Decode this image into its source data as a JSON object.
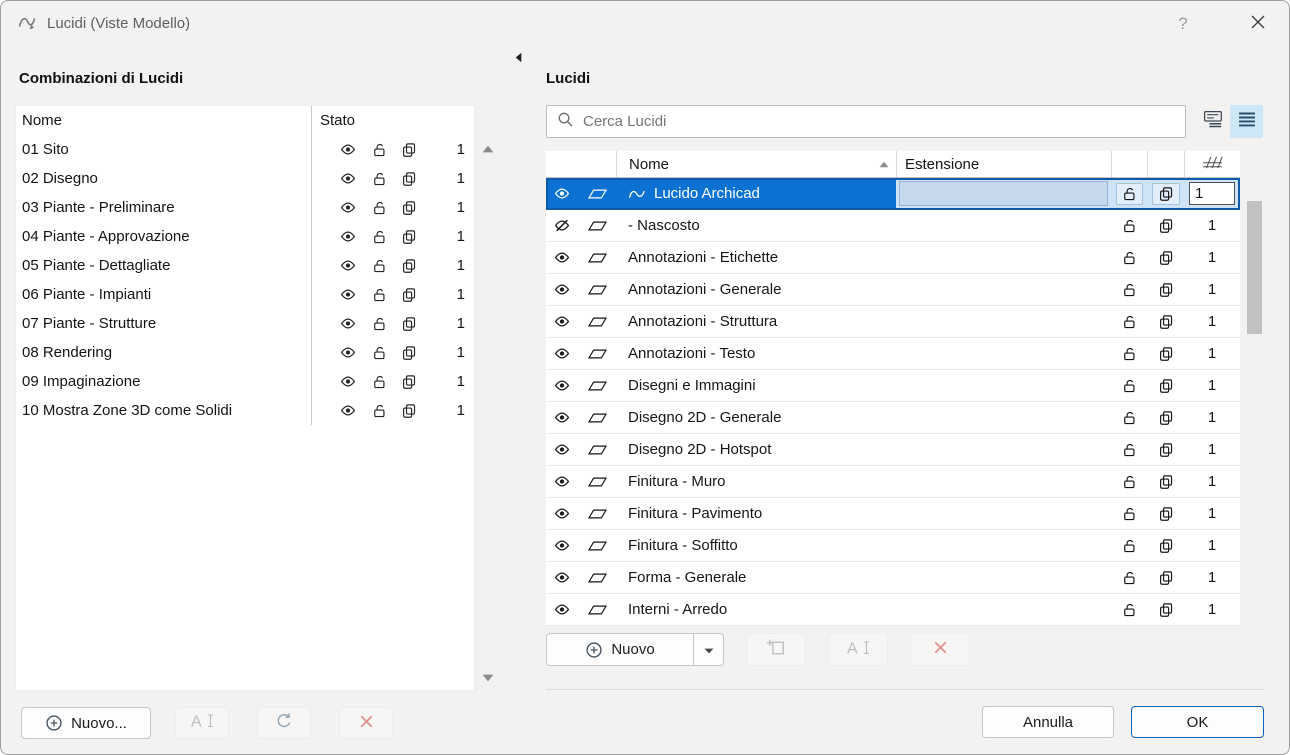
{
  "window": {
    "title": "Lucidi (Viste Modello)",
    "help": "?"
  },
  "left_panel": {
    "title": "Combinazioni di Lucidi",
    "header": {
      "name": "Nome",
      "state": "Stato"
    },
    "rows": [
      {
        "name": "01 Sito",
        "intersection": "1"
      },
      {
        "name": "02 Disegno",
        "intersection": "1"
      },
      {
        "name": "03 Piante - Preliminare",
        "intersection": "1"
      },
      {
        "name": "04 Piante - Approvazione",
        "intersection": "1"
      },
      {
        "name": "05 Piante - Dettagliate",
        "intersection": "1"
      },
      {
        "name": "06 Piante - Impianti",
        "intersection": "1"
      },
      {
        "name": "07 Piante - Strutture",
        "intersection": "1"
      },
      {
        "name": "08 Rendering",
        "intersection": "1"
      },
      {
        "name": "09 Impaginazione",
        "intersection": "1"
      },
      {
        "name": "10 Mostra Zone 3D come Solidi",
        "intersection": "1"
      }
    ],
    "new_button": "Nuovo..."
  },
  "right_panel": {
    "title": "Lucidi",
    "search_placeholder": "Cerca Lucidi",
    "header": {
      "name": "Nome",
      "extension": "Estensione"
    },
    "sort": "ascending",
    "rows": [
      {
        "name": "Lucido Archicad",
        "intersection": "1",
        "selected": true,
        "hidden": false,
        "extension": ""
      },
      {
        "name": "- Nascosto",
        "intersection": "1",
        "hidden": true
      },
      {
        "name": "Annotazioni - Etichette",
        "intersection": "1"
      },
      {
        "name": "Annotazioni - Generale",
        "intersection": "1"
      },
      {
        "name": "Annotazioni - Struttura",
        "intersection": "1"
      },
      {
        "name": "Annotazioni - Testo",
        "intersection": "1"
      },
      {
        "name": "Disegni e Immagini",
        "intersection": "1"
      },
      {
        "name": "Disegno 2D - Generale",
        "intersection": "1"
      },
      {
        "name": "Disegno 2D - Hotspot",
        "intersection": "1"
      },
      {
        "name": "Finitura - Muro",
        "intersection": "1"
      },
      {
        "name": "Finitura - Pavimento",
        "intersection": "1"
      },
      {
        "name": "Finitura - Soffitto",
        "intersection": "1"
      },
      {
        "name": "Forma - Generale",
        "intersection": "1"
      },
      {
        "name": "Interni - Arredo",
        "intersection": "1"
      }
    ],
    "new_button": "Nuovo"
  },
  "footer": {
    "cancel": "Annulla",
    "ok": "OK"
  },
  "colors": {
    "selection_blue": "#0b72d4",
    "selection_border": "#0d5ba8",
    "active_toggle_bg": "#cde6f8",
    "delete_red": "#e2938d"
  },
  "icons": {
    "app-icon": "archicad-curve-pen",
    "help-icon": "question-mark",
    "close-icon": "x",
    "search-icon": "magnifier",
    "tree-view-icon": "hierarchy-list",
    "list-view-icon": "flat-list",
    "visibility-eye-icon": "eye",
    "hidden-eye-icon": "eye-slash",
    "lock-icon": "open-padlock",
    "solid-view-icon": "stacked-pages",
    "layer-parallelogram-icon": "parallelogram",
    "spline-icon": "curve",
    "fence-icon": "diagonal-hatch",
    "sort-ascending-icon": "triangle-up",
    "plus-circle-icon": "plus-in-circle",
    "caret-down-icon": "triangle-down",
    "page-plus-icon": "page-with-plus",
    "rename-icon": "letter-A-with-text-cursor",
    "refresh-icon": "circular-arrows",
    "delete-x-icon": "x",
    "collapse-arrow-icon": "triangle-left",
    "scroll-up-icon": "triangle-up",
    "scroll-down-icon": "triangle-down"
  }
}
